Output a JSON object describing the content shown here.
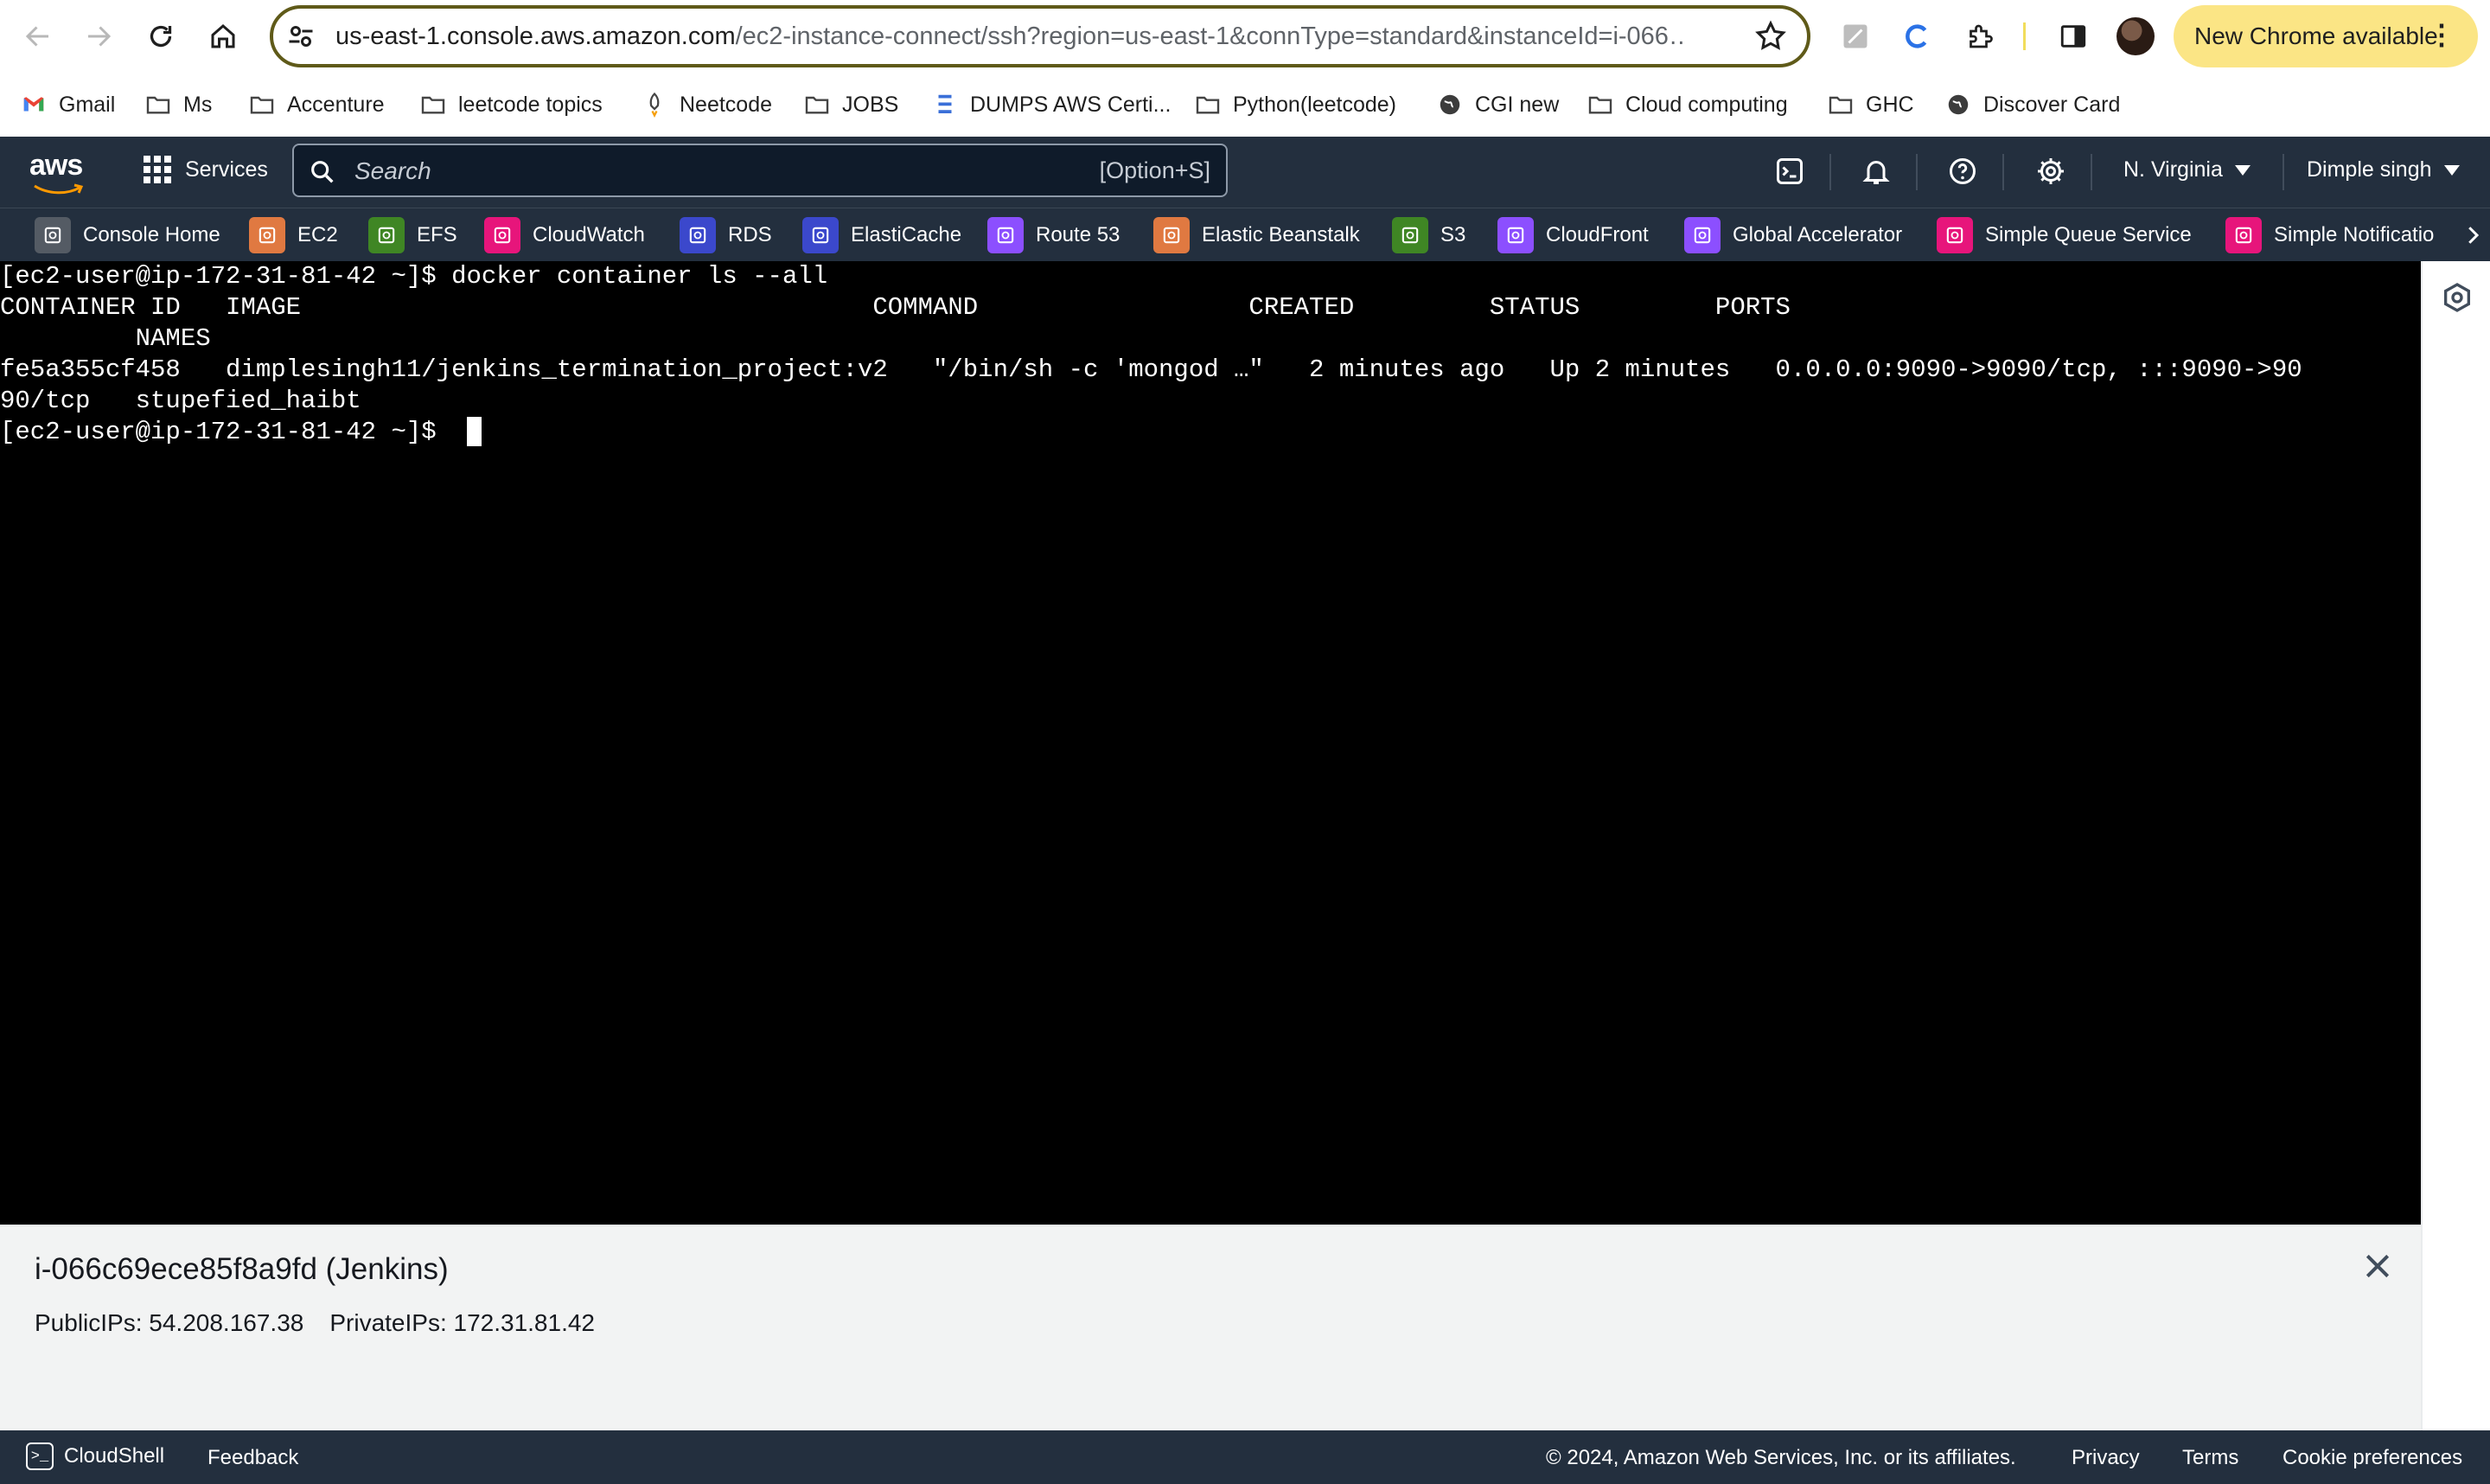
{
  "browser": {
    "url_host": "us-east-1.console.aws.amazon.com",
    "url_path": "/ec2-instance-connect/ssh?region=us-east-1&connType=standard&instanceId=i-066…",
    "update_label": "New Chrome available"
  },
  "bookmarks": [
    {
      "label": "Gmail",
      "icon": "gmail-icon"
    },
    {
      "label": "Ms",
      "icon": "folder-icon"
    },
    {
      "label": "Accenture",
      "icon": "folder-icon"
    },
    {
      "label": "leetcode topics",
      "icon": "folder-icon"
    },
    {
      "label": "Neetcode",
      "icon": "rocket-icon"
    },
    {
      "label": "JOBS",
      "icon": "folder-icon"
    },
    {
      "label": "DUMPS AWS Certi...",
      "icon": "dumps-icon"
    },
    {
      "label": "Python(leetcode)",
      "icon": "folder-icon"
    },
    {
      "label": "CGI new",
      "icon": "globe-icon"
    },
    {
      "label": "Cloud computing",
      "icon": "folder-icon"
    },
    {
      "label": "GHC",
      "icon": "folder-icon"
    },
    {
      "label": "Discover Card",
      "icon": "globe-icon"
    }
  ],
  "aws": {
    "logo": "aws",
    "services_label": "Services",
    "search_placeholder": "Search",
    "search_shortcut": "[Option+S]",
    "region": "N. Virginia",
    "user": "Dimple singh",
    "favorites": [
      {
        "label": "Console Home",
        "color": "#545b64"
      },
      {
        "label": "EC2",
        "color": "#e07941"
      },
      {
        "label": "EFS",
        "color": "#3f8624"
      },
      {
        "label": "CloudWatch",
        "color": "#e7157b"
      },
      {
        "label": "RDS",
        "color": "#3b48cc"
      },
      {
        "label": "ElastiCache",
        "color": "#3b48cc"
      },
      {
        "label": "Route 53",
        "color": "#8c4fff"
      },
      {
        "label": "Elastic Beanstalk",
        "color": "#e07941"
      },
      {
        "label": "S3",
        "color": "#3f8624"
      },
      {
        "label": "CloudFront",
        "color": "#8c4fff"
      },
      {
        "label": "Global Accelerator",
        "color": "#8c4fff"
      },
      {
        "label": "Simple Queue Service",
        "color": "#e7157b"
      },
      {
        "label": "Simple Notificatio",
        "color": "#e7157b"
      }
    ]
  },
  "terminal": {
    "lines": [
      "[ec2-user@ip-172-31-81-42 ~]$ docker container ls --all",
      "CONTAINER ID   IMAGE                                      COMMAND                  CREATED         STATUS         PORTS",
      "         NAMES",
      "fe5a355cf458   dimplesingh11/jenkins_termination_project:v2   \"/bin/sh -c 'mongod …\"   2 minutes ago   Up 2 minutes   0.0.0.0:9090->9090/tcp, :::9090->90",
      "90/tcp   stupefied_haibt",
      "[ec2-user@ip-172-31-81-42 ~]$ "
    ]
  },
  "instance": {
    "title": "i-066c69ece85f8a9fd (Jenkins)",
    "public_ips": "PublicIPs: 54.208.167.38",
    "private_ips": "PrivateIPs: 172.31.81.42"
  },
  "footer": {
    "cloudshell": "CloudShell",
    "feedback": "Feedback",
    "copyright": "© 2024, Amazon Web Services, Inc. or its affiliates.",
    "privacy": "Privacy",
    "terms": "Terms",
    "cookies": "Cookie preferences"
  }
}
